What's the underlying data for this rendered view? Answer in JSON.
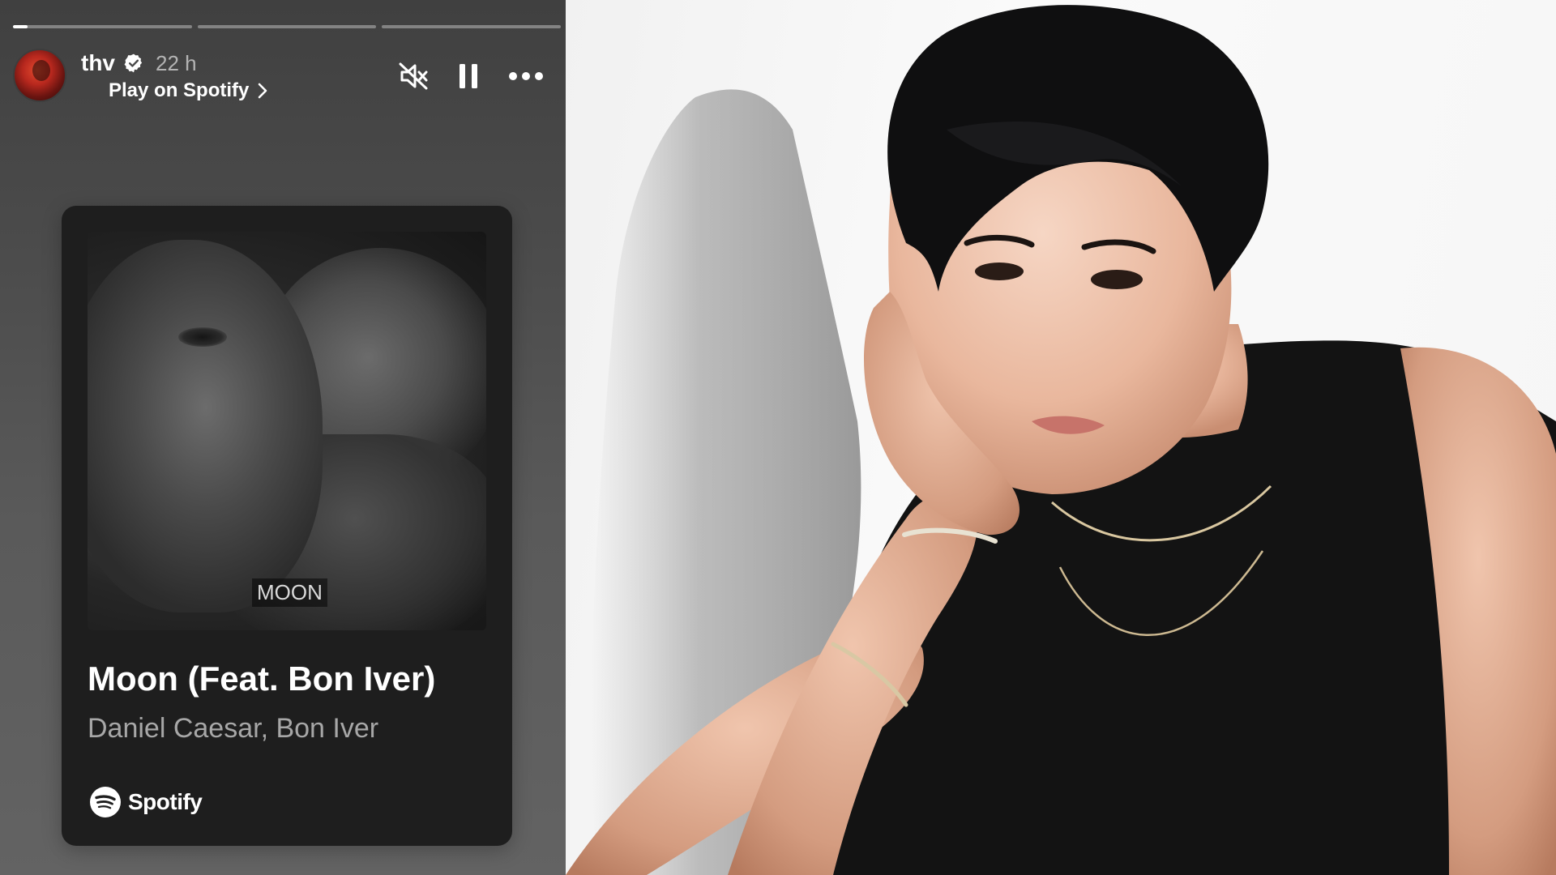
{
  "story": {
    "progress": [
      0.08,
      0,
      0
    ],
    "user": {
      "name": "thv",
      "verified": true,
      "time": "22 h"
    },
    "music_link": "Play on Spotify",
    "controls": {
      "mute_icon": "speaker-muted-icon",
      "pause_icon": "pause-icon",
      "more_icon": "more-horizontal-icon"
    }
  },
  "track": {
    "cover_title": "MOON",
    "title": "Moon (Feat. Bon Iver)",
    "artists": "Daniel Caesar, Bon Iver",
    "brand": "Spotify"
  },
  "colors": {
    "card_bg": "#1e1e1e",
    "artist_text": "#a7a7a7",
    "story_bg": "#4c4c4c"
  }
}
